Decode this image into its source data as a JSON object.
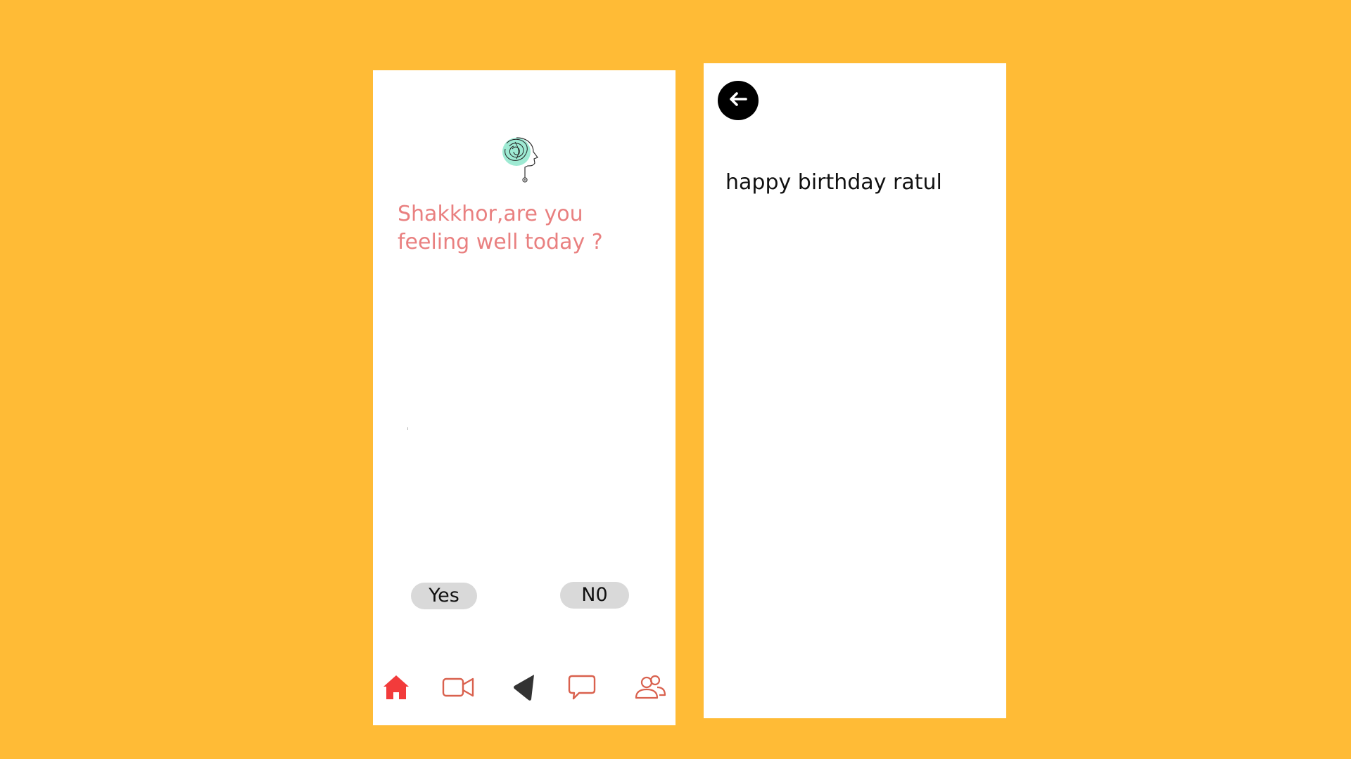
{
  "left_screen": {
    "logo_icon": "brain-head-icon",
    "question": "Shakkhor,are you feeling well today ?",
    "yes_label": "Yes",
    "no_label": "N0",
    "nav": [
      {
        "icon": "home-icon",
        "active": true,
        "color": "#F23B3B"
      },
      {
        "icon": "video-camera-icon",
        "active": false,
        "color": "#D9614E"
      },
      {
        "icon": "navigation-arrow-icon",
        "active": false,
        "color": "#333333"
      },
      {
        "icon": "chat-bubble-icon",
        "active": false,
        "color": "#D9614E"
      },
      {
        "icon": "users-icon",
        "active": false,
        "color": "#D9614E"
      }
    ]
  },
  "right_screen": {
    "back_icon": "arrow-left-icon",
    "message": "happy birthday ratul"
  },
  "colors": {
    "background": "#FFBB36",
    "question_text": "#E98080",
    "pill_bg": "#D9D9D9",
    "nav_active": "#F23B3B",
    "nav_icon": "#D9614E"
  }
}
